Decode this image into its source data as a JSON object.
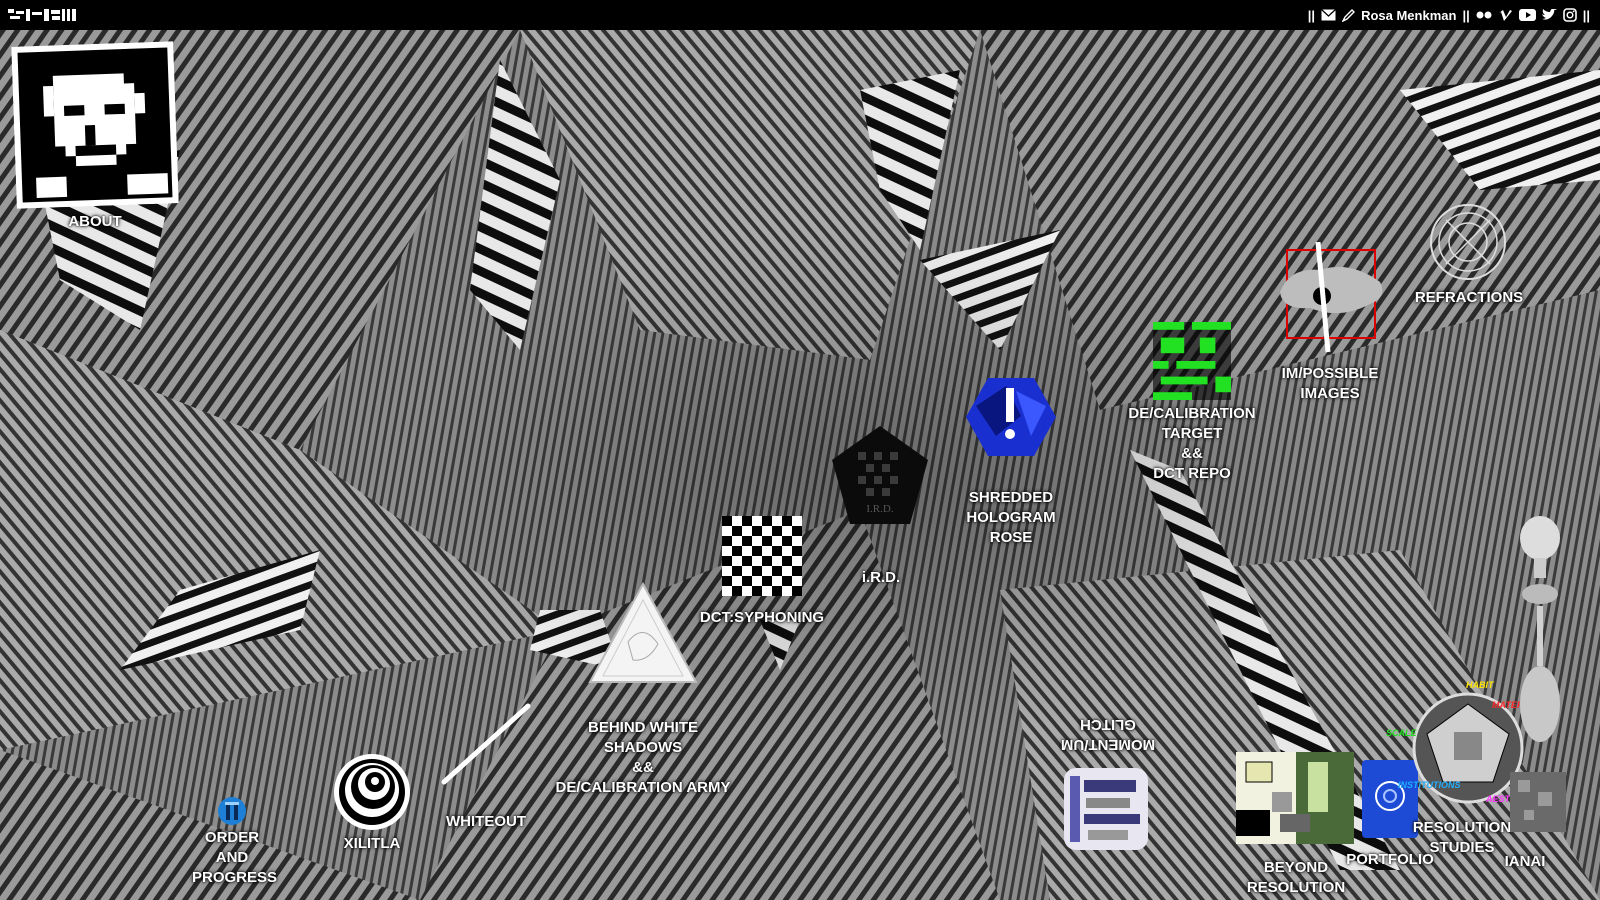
{
  "topbar": {
    "separator_left": "||",
    "author_name": "Rosa Menkman",
    "separator_mid": "||",
    "separator_right": "||",
    "icons": [
      "mail-icon",
      "pen-icon",
      "flickr-icon",
      "vimeo-icon",
      "youtube-icon",
      "twitter-icon",
      "instagram-icon"
    ]
  },
  "items": {
    "about": {
      "label": "ABOUT"
    },
    "refractions": {
      "label": "REFRACTIONS"
    },
    "impossible_images": {
      "line1": "IM/POSSIBLE",
      "line2": "IMAGES"
    },
    "decalibration": {
      "line1": "DE/CALIBRATION",
      "line2": "TARGET",
      "line3": "&&",
      "line4": "DCT REPO"
    },
    "shredded": {
      "line1": "SHREDDED",
      "line2": "HOLOGRAM",
      "line3": "ROSE"
    },
    "ird": {
      "label": "i.R.D."
    },
    "dct": {
      "label": "DCT:SYPHONING"
    },
    "behind": {
      "line1": "BEHIND WHITE",
      "line2": "SHADOWS",
      "line3": "&&",
      "line4": "DE/CALIBRATION ARMY"
    },
    "glitch": {
      "line1": "GLITCH",
      "line2": "MOMENT/UM"
    },
    "whiteout": {
      "label": "WHITEOUT"
    },
    "xilitla": {
      "label": "XILITLA"
    },
    "order": {
      "line1": "ORDER",
      "line2": "AND",
      "line3": "PROGRESS"
    },
    "beyond": {
      "line1": "BEYOND",
      "line2": "RESOLUTION"
    },
    "portfolio": {
      "label": "PORTFOLIO"
    },
    "resolution": {
      "line1": "RESOLUTION",
      "line2": "STUDIES"
    },
    "ianai": {
      "label": "IANAI"
    }
  },
  "resolution_words": {
    "habit": "HABIT",
    "materiality": "MATERIALITY",
    "scale": "SCALE",
    "institutions": "INSTITUTIONS",
    "aesthetics": "AESTHETICS"
  },
  "ird_badge": "I.R.D.",
  "colors": {
    "topbar_bg": "#000000",
    "label_text": "#ffffff",
    "shredded_blue": "#1a2fd0",
    "decal_green": "#22e022",
    "portfolio_blue": "#1d4bd6"
  }
}
